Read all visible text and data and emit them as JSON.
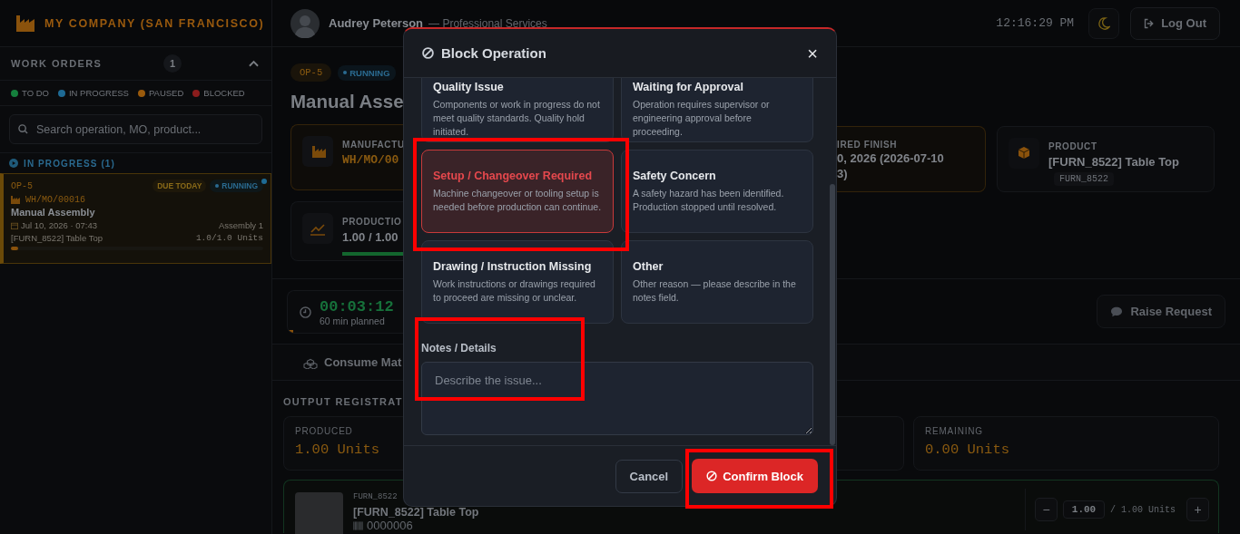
{
  "header": {
    "company": "MY COMPANY (SAN FRANCISCO)",
    "user": {
      "name": "Audrey Peterson",
      "role": "— Professional Services"
    },
    "clock": "12:16:29 PM",
    "logout": "Log Out"
  },
  "sidebar": {
    "title": "WORK ORDERS",
    "count": "1",
    "expanded": true,
    "legend": [
      {
        "label": "TO DO",
        "color": "#15803d"
      },
      {
        "label": "IN PROGRESS",
        "color": "#1e6a94"
      },
      {
        "label": "PAUSED",
        "color": "#9a5a0c"
      },
      {
        "label": "BLOCKED",
        "color": "#8a1c1c"
      }
    ],
    "search": {
      "placeholder": "Search operation, MO, product..."
    },
    "group": {
      "label": "IN PROGRESS (1)",
      "orders": [
        {
          "op": "OP-5",
          "due": "DUE TODAY",
          "status": "RUNNING",
          "mo": "WH/MO/00016",
          "name": "Manual Assembly",
          "date": "Jul 10, 2026 · 07:43",
          "workcenter": "Assembly 1",
          "product": "[FURN_8522] Table Top",
          "qty": "1.0/1.0 Units",
          "level": 0.03,
          "selected": true
        }
      ]
    }
  },
  "main": {
    "badges": [
      {
        "label": "OP-5",
        "kind": "op"
      },
      {
        "label": "RUNNING",
        "kind": "status"
      }
    ],
    "title": "Manual Asse",
    "manufacturing": {
      "label": "MANUFACTU",
      "value": "WH/MO/00"
    },
    "production": {
      "label": "PRODUCTIO",
      "value": "1.00 / 1.00",
      "level": 1
    },
    "finish": {
      "label": "IRED FINISH",
      "lines": [
        "0, 2026 (2026-07-10",
        "3)"
      ]
    },
    "product": {
      "label": "PRODUCT",
      "value": "[FURN_8522] Table Top",
      "code": "FURN_8522"
    },
    "timer": {
      "elapsed": "00:03:12",
      "planned": "60 min planned",
      "level": 0.05
    },
    "raise": "Raise Request",
    "tab": "Consume Mat",
    "output": {
      "title": "OUTPUT REGISTRAT",
      "produced": {
        "label": "PRODUCED",
        "value": "1.00 Units"
      },
      "remaining": {
        "label": "REMAINING",
        "value": "0.00 Units"
      },
      "item": {
        "code": "FURN_8522",
        "name": "[FURN_8522] Table Top",
        "barcode": "0000006",
        "minus": "−",
        "qty": "1.00",
        "total": "/ 1.00 Units",
        "plus": "+"
      }
    }
  },
  "modal": {
    "title": "Block Operation",
    "close": "×",
    "reasons": [
      {
        "title": "Quality Issue",
        "description": "Components or work in progress do not meet quality standards. Quality hold initiated.",
        "selected": false
      },
      {
        "title": "Waiting for Approval",
        "description": "Operation requires supervisor or engineering approval before proceeding.",
        "selected": false
      },
      {
        "title": "Setup / Changeover Required",
        "description": "Machine changeover or tooling setup is needed before production can continue.",
        "selected": true
      },
      {
        "title": "Safety Concern",
        "description": "A safety hazard has been identified. Production stopped until resolved.",
        "selected": false
      },
      {
        "title": "Drawing / Instruction Missing",
        "description": "Work instructions or drawings required to proceed are missing or unclear.",
        "selected": false
      },
      {
        "title": "Other",
        "description": "Other reason — please describe in the notes field.",
        "selected": false
      }
    ],
    "notes": {
      "label": "Notes / Details",
      "placeholder": "Describe the issue..."
    },
    "cancel": "Cancel",
    "confirm": "Confirm Block"
  }
}
